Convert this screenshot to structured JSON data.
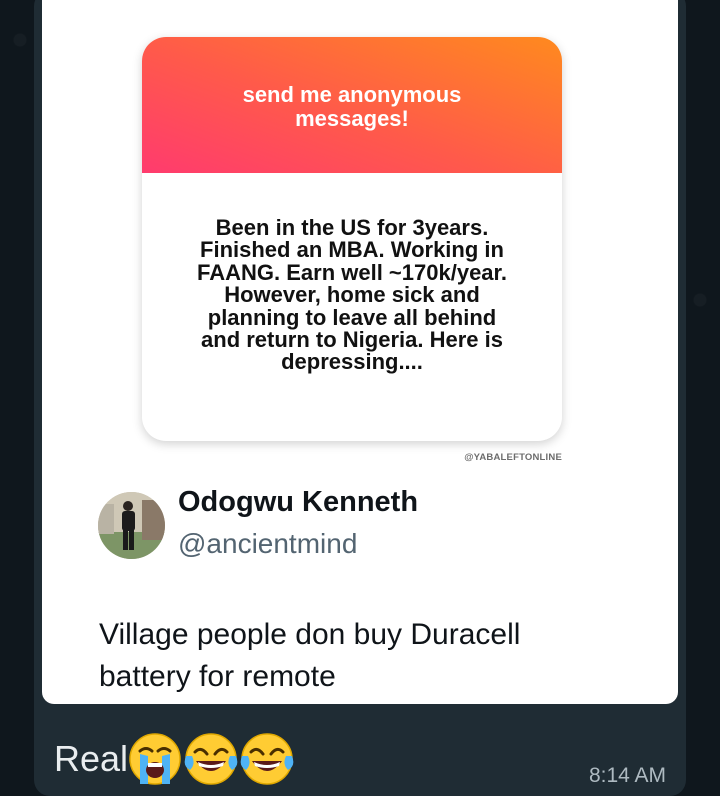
{
  "post": {
    "prompt_title": "send me anonymous\nmessages!",
    "anonymous_message": "Been in the US for 3years.\nFinished an MBA. Working in\nFAANG. Earn well ~170k/year.\nHowever, home sick and\nplanning to leave all behind\nand return to Nigeria. Here is\ndepressing....",
    "watermark": "@YABALEFTONLINE"
  },
  "tweet": {
    "author_name": "Odogwu Kenneth",
    "author_handle": "@ancientmind",
    "text": "Village people don buy Duracell\nbattery for remote"
  },
  "message": {
    "caption": "Real",
    "emojis": [
      "loudly-crying-face",
      "face-with-tears-of-joy",
      "face-with-tears-of-joy"
    ],
    "time": "8:14 AM"
  },
  "colors": {
    "chat_background": "#0f171d",
    "bubble": "#1f2c34",
    "gradient_start": "#ff3b6e",
    "gradient_end": "#ff8a1e",
    "handle_gray": "#536471"
  }
}
